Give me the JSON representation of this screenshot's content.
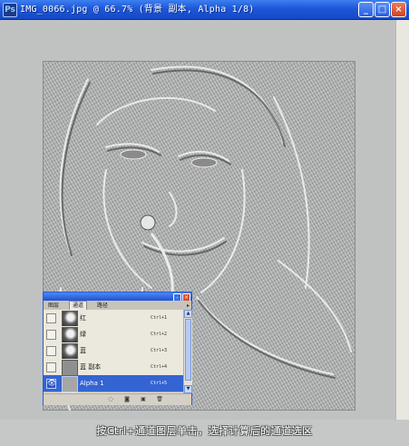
{
  "window": {
    "title": "IMG_0066.jpg @ 66.7% (背景 副本, Alpha 1/8)",
    "app_icon": "photoshop-icon",
    "buttons": {
      "minimize": "_",
      "maximize": "□",
      "close": "×"
    }
  },
  "layers_panel": {
    "tabs": [
      {
        "label": "图层"
      },
      {
        "label": "通道",
        "active": true
      },
      {
        "label": "路径"
      }
    ],
    "menu_icon": "panel-menu-icon",
    "rows": [
      {
        "name": "红",
        "shortcut": "Ctrl+1",
        "thumb": "photo",
        "visible": false,
        "selected": false
      },
      {
        "name": "绿",
        "shortcut": "Ctrl+2",
        "thumb": "photo",
        "visible": false,
        "selected": false
      },
      {
        "name": "蓝",
        "shortcut": "Ctrl+3",
        "thumb": "photo",
        "visible": false,
        "selected": false
      },
      {
        "name": "蓝 副本",
        "shortcut": "Ctrl+4",
        "thumb": "gray",
        "visible": false,
        "selected": false
      },
      {
        "name": "Alpha 1",
        "shortcut": "Ctrl+5",
        "thumb": "gray",
        "visible": true,
        "selected": true
      }
    ],
    "eye_glyph": "👁",
    "footer_icons": [
      "load-selection-icon",
      "save-selection-icon",
      "new-channel-icon",
      "delete-icon"
    ]
  },
  "caption": "按Ctrl+通道图层单击，选择计算后的通道选区",
  "colors": {
    "title_bar": "#1d58d8",
    "selected_row": "#3464d2",
    "window_bg": "#c6c8c8"
  }
}
